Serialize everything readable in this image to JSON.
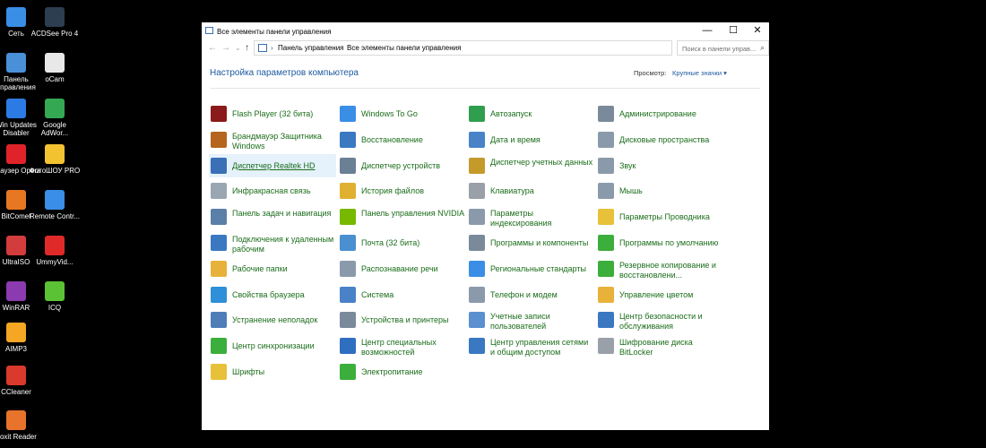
{
  "desktop": [
    {
      "label": "Сеть",
      "icon": "network-icon",
      "color": "#3a8ee6"
    },
    {
      "label": "ACDSee Pro 4",
      "icon": "acdsee-icon",
      "color": "#2c3e50"
    },
    {
      "label": "Панель управления",
      "icon": "control-panel-icon",
      "color": "#4a90d9"
    },
    {
      "label": "oCam",
      "icon": "ocam-icon",
      "color": "#e8e8e8"
    },
    {
      "label": "Win Updates Disabler",
      "icon": "win-updates-icon",
      "color": "#2c7be5"
    },
    {
      "label": "Google AdWor...",
      "icon": "google-adwords-icon",
      "color": "#34a853"
    },
    {
      "label": "Браузер Opera",
      "icon": "opera-icon",
      "color": "#e0232b"
    },
    {
      "label": "ФотоШОУ PRO",
      "icon": "fotoshow-icon",
      "color": "#f2c230"
    },
    {
      "label": "BitComet",
      "icon": "bitcomet-icon",
      "color": "#e87722"
    },
    {
      "label": "Remote Contr...",
      "icon": "remote-control-icon",
      "color": "#3a8ee6"
    },
    {
      "label": "UltraISO",
      "icon": "ultraiso-icon",
      "color": "#d23c3c"
    },
    {
      "label": "UmmyVid...",
      "icon": "ummy-icon",
      "color": "#e02a2a"
    },
    {
      "label": "WinRAR",
      "icon": "winrar-icon",
      "color": "#8b3ab0"
    },
    {
      "label": "ICQ",
      "icon": "icq-icon",
      "color": "#5bc236"
    },
    {
      "label": "AIMP3",
      "icon": "aimp-icon",
      "color": "#f5a623"
    },
    {
      "label": "CCleaner",
      "icon": "ccleaner-icon",
      "color": "#d93a2b"
    },
    {
      "label": "Foxit Reader",
      "icon": "foxit-icon",
      "color": "#e8732a"
    }
  ],
  "window": {
    "title": "Все элементы панели управления",
    "controls": {
      "minimize": "—",
      "maximize": "☐",
      "close": "✕"
    },
    "nav": {
      "back": "←",
      "forward": "→",
      "dropdown": "⌄",
      "up": "↑"
    },
    "breadcrumb": [
      "Панель управления",
      "Все элементы панели управления"
    ],
    "breadcrumb_sep": "›",
    "search_placeholder": "Поиск в панели управ...",
    "heading": "Настройка параметров компьютера",
    "view_label": "Просмотр:",
    "view_value": "Крупные значки ▾"
  },
  "columns": [
    [
      {
        "label": "Flash Player (32 бита)",
        "icon": "flash-player-icon",
        "color": "#8b1a1a"
      },
      {
        "label": "Брандмауэр Защитника Windows",
        "icon": "firewall-icon",
        "color": "#b5651d"
      },
      {
        "label": "Диспетчер Realtek HD",
        "icon": "realtek-icon",
        "color": "#3b6fb6",
        "highlight": true
      },
      {
        "label": "Инфракрасная связь",
        "icon": "infrared-icon",
        "color": "#9aa6b2"
      },
      {
        "label": "Панель задач и навигация",
        "icon": "taskbar-icon",
        "color": "#5a7fa8"
      },
      {
        "label": "Подключения к удаленным рабочим",
        "icon": "remote-desktop-icon",
        "color": "#3a78c2"
      },
      {
        "label": "Рабочие папки",
        "icon": "work-folders-icon",
        "color": "#e8b23a"
      },
      {
        "label": "Свойства браузера",
        "icon": "browser-props-icon",
        "color": "#2f8fd8"
      },
      {
        "label": "Устранение неполадок",
        "icon": "troubleshoot-icon",
        "color": "#4f7db8"
      },
      {
        "label": "Центр синхронизации",
        "icon": "sync-center-icon",
        "color": "#3bae3b"
      },
      {
        "label": "Шрифты",
        "icon": "fonts-icon",
        "color": "#e8c13a"
      }
    ],
    [
      {
        "label": "Windows To Go",
        "icon": "windows-to-go-icon",
        "color": "#3a8ee6"
      },
      {
        "label": "Восстановление",
        "icon": "recovery-icon",
        "color": "#3a78c2"
      },
      {
        "label": "Диспетчер устройств",
        "icon": "device-manager-icon",
        "color": "#6b7f95"
      },
      {
        "label": "История файлов",
        "icon": "file-history-icon",
        "color": "#e0b030"
      },
      {
        "label": "Панель управления NVIDIA",
        "icon": "nvidia-icon",
        "color": "#76b900"
      },
      {
        "label": "Почта (32 бита)",
        "icon": "mail-icon",
        "color": "#4a8fd0"
      },
      {
        "label": "Распознавание речи",
        "icon": "speech-icon",
        "color": "#8a9aab"
      },
      {
        "label": "Система",
        "icon": "system-icon",
        "color": "#4a82c8"
      },
      {
        "label": "Устройства и принтеры",
        "icon": "printers-icon",
        "color": "#7a8a9a"
      },
      {
        "label": "Центр специальных возможностей",
        "icon": "accessibility-icon",
        "color": "#2f6fc0"
      },
      {
        "label": "Электропитание",
        "icon": "power-icon",
        "color": "#3bae3b"
      }
    ],
    [
      {
        "label": "Автозапуск",
        "icon": "autoplay-icon",
        "color": "#2f9e4f"
      },
      {
        "label": "Дата и время",
        "icon": "date-time-icon",
        "color": "#4a82c8"
      },
      {
        "label": "Диспетчер учетных данных",
        "icon": "credential-icon",
        "color": "#c49a2a"
      },
      {
        "label": "Клавиатура",
        "icon": "keyboard-icon",
        "color": "#9aa0a8"
      },
      {
        "label": "Параметры индексирования",
        "icon": "indexing-icon",
        "color": "#8a9aab"
      },
      {
        "label": "Программы и компоненты",
        "icon": "programs-icon",
        "color": "#7a8a9a"
      },
      {
        "label": "Региональные стандарты",
        "icon": "region-icon",
        "color": "#3a8ee6"
      },
      {
        "label": "Телефон и модем",
        "icon": "phone-icon",
        "color": "#8a9aab"
      },
      {
        "label": "Учетные записи пользователей",
        "icon": "user-accounts-icon",
        "color": "#5a8fd0"
      },
      {
        "label": "Центр управления сетями и общим доступом",
        "icon": "network-center-icon",
        "color": "#3a78c2"
      }
    ],
    [
      {
        "label": "Администрирование",
        "icon": "admin-tools-icon",
        "color": "#7a8a9a"
      },
      {
        "label": "Дисковые пространства",
        "icon": "storage-spaces-icon",
        "color": "#8a9aab"
      },
      {
        "label": "Звук",
        "icon": "sound-icon",
        "color": "#8a9aab"
      },
      {
        "label": "Мышь",
        "icon": "mouse-icon",
        "color": "#8a9aab"
      },
      {
        "label": "Параметры Проводника",
        "icon": "explorer-options-icon",
        "color": "#e8c13a"
      },
      {
        "label": "Программы по умолчанию",
        "icon": "default-programs-icon",
        "color": "#3bae3b"
      },
      {
        "label": "Резервное копирование и восстановлени...",
        "icon": "backup-icon",
        "color": "#3bae3b"
      },
      {
        "label": "Управление цветом",
        "icon": "color-management-icon",
        "color": "#e8b23a"
      },
      {
        "label": "Центр безопасности и обслуживания",
        "icon": "security-center-icon",
        "color": "#3a78c2"
      },
      {
        "label": "Шифрование диска BitLocker",
        "icon": "bitlocker-icon",
        "color": "#9aa0a8"
      }
    ]
  ]
}
